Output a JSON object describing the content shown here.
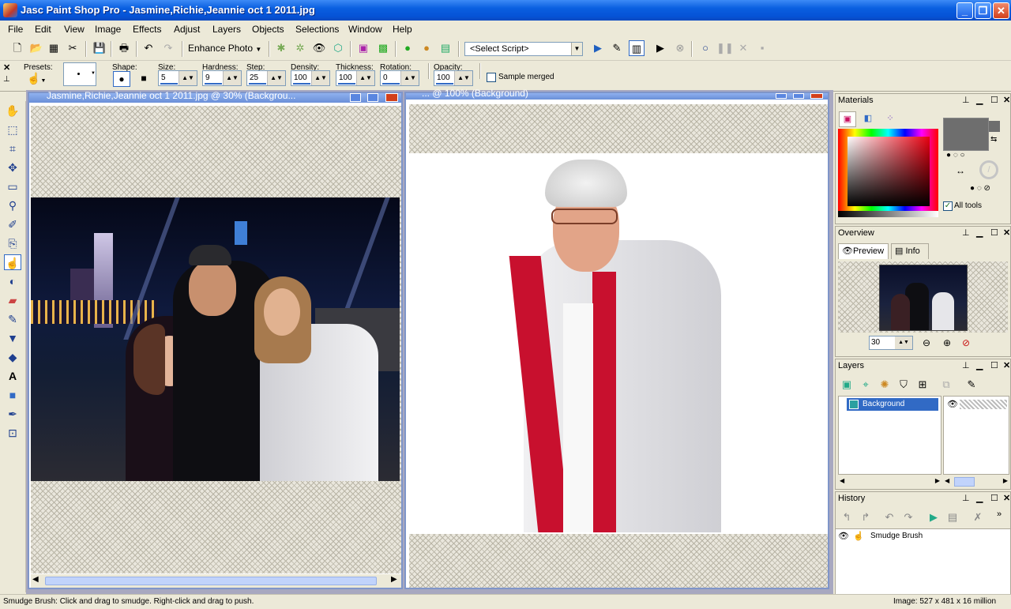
{
  "window": {
    "title": "Jasc Paint Shop Pro - Jasmine,Richie,Jeannie oct 1 2011.jpg",
    "min": "_",
    "max": "❐",
    "close": "✕"
  },
  "menu": [
    "File",
    "Edit",
    "View",
    "Image",
    "Effects",
    "Adjust",
    "Layers",
    "Objects",
    "Selections",
    "Window",
    "Help"
  ],
  "toolbar": {
    "enhance_photo": "Enhance Photo",
    "select_script": "<Select Script>"
  },
  "tool_options": {
    "presets_label": "Presets:",
    "shape_label": "Shape:",
    "size_label": "Size:",
    "size_value": "5",
    "hardness_label": "Hardness:",
    "hardness_value": "9",
    "step_label": "Step:",
    "step_value": "25",
    "density_label": "Density:",
    "density_value": "100",
    "thickness_label": "Thickness:",
    "thickness_value": "100",
    "rotation_label": "Rotation:",
    "rotation_value": "0",
    "opacity_label": "Opacity:",
    "opacity_value": "100",
    "sample_merged": "Sample merged"
  },
  "documents": {
    "doc1_title": "Jasmine,Richie,Jeannie oct 1 2011.jpg @ 30% (Backgrou...",
    "doc2_title": "... @ 100% (Background)"
  },
  "panels": {
    "materials": {
      "title": "Materials",
      "all_tools": "All tools"
    },
    "overview": {
      "title": "Overview",
      "tab_preview": "Preview",
      "tab_info": "Info",
      "zoom_value": "30"
    },
    "layers": {
      "title": "Layers",
      "layer_name": "Background"
    },
    "history": {
      "title": "History",
      "item": "Smudge Brush"
    }
  },
  "status": {
    "hint": "Smudge Brush: Click and drag to smudge. Right-click and drag to push.",
    "image_info": "Image:  527 x 481 x 16 million"
  },
  "colors": {
    "title_bar": "#0a5fe0",
    "selection_blue": "#316ac5",
    "foreground_swatch": "#6e6e6e"
  }
}
